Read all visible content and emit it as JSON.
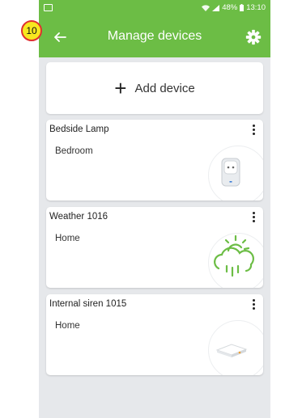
{
  "status_bar": {
    "battery": "48%",
    "time": "13:10"
  },
  "app_bar": {
    "title": "Manage devices",
    "back_icon": "arrow-left-icon",
    "settings_icon": "gear-icon"
  },
  "add_device": {
    "label": "Add device"
  },
  "devices": [
    {
      "name": "Bedside Lamp",
      "room": "Bedroom",
      "icon": "smart-plug-icon"
    },
    {
      "name": "Weather 1016",
      "room": "Home",
      "icon": "weather-icon"
    },
    {
      "name": "Internal siren 1015",
      "room": "Home",
      "icon": "siren-icon"
    }
  ],
  "annotation": {
    "label": "10"
  },
  "colors": {
    "primary_green": "#6cbd45",
    "background": "#e6e8eb",
    "badge_fill": "#f7e81f",
    "badge_border": "#e03030"
  }
}
